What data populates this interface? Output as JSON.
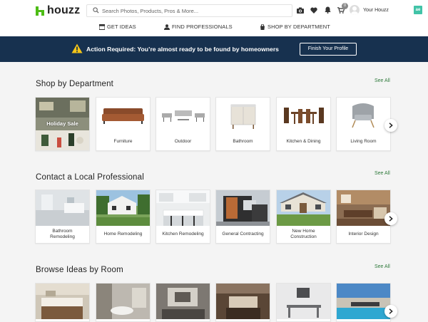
{
  "brand": {
    "name": "houzz",
    "accent": "#4dbc15"
  },
  "search": {
    "placeholder": "Search Photos, Products, Pros & More..."
  },
  "header_icons": [
    "camera-icon",
    "heart-icon",
    "bell-icon",
    "cart-icon"
  ],
  "cart_count": "0",
  "account": {
    "label": "Your Houzz"
  },
  "extension_badge": "ae",
  "nav": [
    {
      "label": "GET IDEAS",
      "icon": "ideas-icon"
    },
    {
      "label": "FIND PROFESSIONALS",
      "icon": "professional-icon"
    },
    {
      "label": "SHOP BY DEPARTMENT",
      "icon": "shop-icon"
    }
  ],
  "banner": {
    "message": "Action Required: You’re almost ready to be found by homeowners",
    "button": "Finish Your Profile",
    "background": "#17314f",
    "warning_color": "#f5c518"
  },
  "sections": {
    "shop": {
      "title": "Shop by Department",
      "see_all": "See All",
      "promo": "Holiday Sale",
      "items": [
        "Furniture",
        "Outdoor",
        "Bathroom",
        "Kitchen & Dining",
        "Living Room"
      ]
    },
    "pros": {
      "title": "Contact a Local Professional",
      "see_all": "See All",
      "items": [
        "Bathroom Remodeling",
        "Home Remodeling",
        "Kitchen Remodeling",
        "General Contracting",
        "New Home Construction",
        "Interior Design"
      ]
    },
    "ideas": {
      "title": "Browse Ideas by Room",
      "see_all": "See All"
    }
  },
  "link_color": "#2f7a3c"
}
